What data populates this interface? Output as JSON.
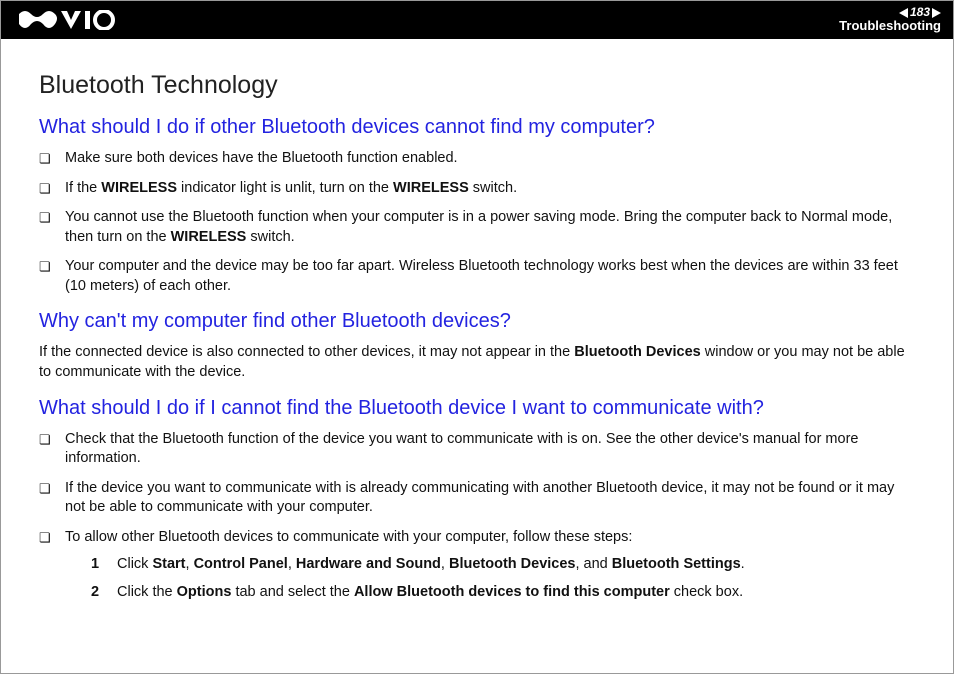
{
  "header": {
    "page_number": "183",
    "section": "Troubleshooting"
  },
  "page": {
    "title": "Bluetooth Technology",
    "q1": {
      "heading": "What should I do if other Bluetooth devices cannot find my computer?",
      "items": [
        {
          "pre": "Make sure both devices have the Bluetooth function enabled."
        },
        {
          "pre": "If the ",
          "b1": "WIRELESS",
          "mid": " indicator light is unlit, turn on the ",
          "b2": "WIRELESS",
          "post": " switch."
        },
        {
          "pre": "You cannot use the Bluetooth function when your computer is in a power saving mode. Bring the computer back to Normal mode, then turn on the ",
          "b1": "WIRELESS",
          "post": " switch."
        },
        {
          "pre": "Your computer and the device may be too far apart. Wireless Bluetooth technology works best when the devices are within 33 feet (10 meters) of each other."
        }
      ]
    },
    "q2": {
      "heading": "Why can't my computer find other Bluetooth devices?",
      "body_pre": "If the connected device is also connected to other devices, it may not appear in the ",
      "body_b": "Bluetooth Devices",
      "body_post": " window or you may not be able to communicate with the device."
    },
    "q3": {
      "heading": "What should I do if I cannot find the Bluetooth device I want to communicate with?",
      "items": [
        "Check that the Bluetooth function of the device you want to communicate with is on. See the other device's manual for more information.",
        "If the device you want to communicate with is already communicating with another Bluetooth device, it may not be found or it may not be able to communicate with your computer.",
        "To allow other Bluetooth devices to communicate with your computer, follow these steps:"
      ],
      "steps": {
        "s1": {
          "t0": "Click ",
          "b0": "Start",
          "c0": ", ",
          "b1": "Control Panel",
          "c1": ", ",
          "b2": "Hardware and Sound",
          "c2": ", ",
          "b3": "Bluetooth Devices",
          "c3": ", and ",
          "b4": "Bluetooth Settings",
          "c4": "."
        },
        "s2": {
          "t0": "Click the ",
          "b0": "Options",
          "t1": " tab and select the ",
          "b1": "Allow Bluetooth devices to find this computer",
          "t2": " check box."
        }
      }
    }
  }
}
